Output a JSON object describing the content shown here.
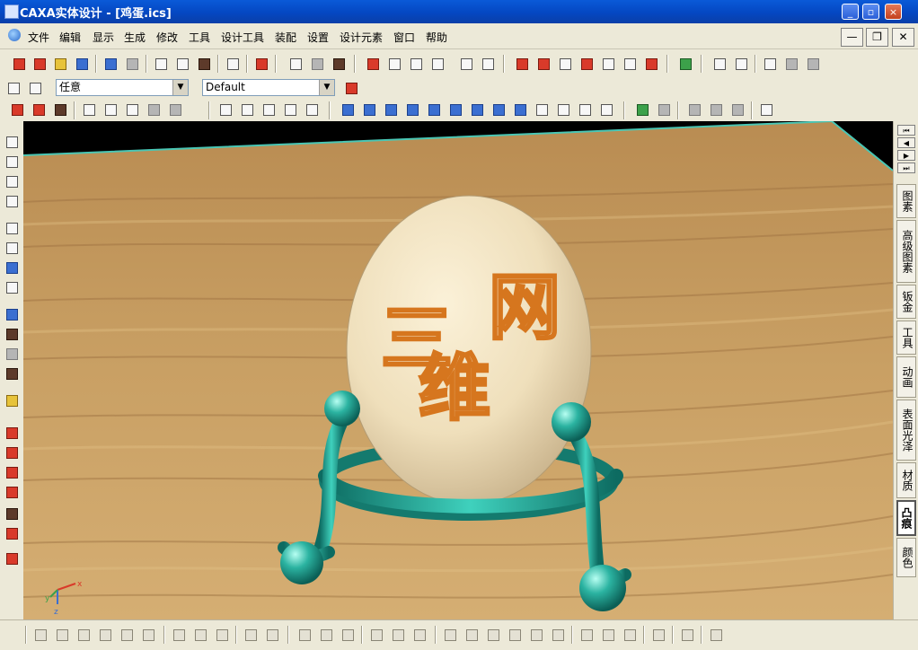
{
  "window": {
    "title": "CAXA实体设计 - [鸡蛋.ics]",
    "minimize": "_",
    "maximize": "▫",
    "close": "×"
  },
  "menu": {
    "items": [
      {
        "label": "文件"
      },
      {
        "label": "编辑"
      },
      {
        "label": "显示"
      },
      {
        "label": "生成"
      },
      {
        "label": "修改"
      },
      {
        "label": "工具"
      },
      {
        "label": "设计工具"
      },
      {
        "label": "装配"
      },
      {
        "label": "设置"
      },
      {
        "label": "设计元素"
      },
      {
        "label": "窗口"
      },
      {
        "label": "帮助"
      }
    ],
    "doc_minimize": "—",
    "doc_restore": "❐",
    "doc_close": "✕"
  },
  "selection": {
    "filter_value": "任意",
    "layer_value": "Default"
  },
  "design_elements": {
    "tabs": [
      "图素",
      "高级图素",
      "钣金",
      "工具",
      "动画",
      "表面光泽",
      "材质",
      "凸痕",
      "颜色"
    ],
    "active_tab": "凸痕"
  },
  "scene": {
    "egg_text": [
      "三",
      "网",
      "维"
    ],
    "colors": {
      "egg": "#f1e3c2",
      "embossed_text": "#d6761e",
      "stand": "#1f9a8b",
      "table_wood": "#c79a5a"
    },
    "axis_labels": {
      "x": "x",
      "y": "y",
      "z": "z"
    }
  },
  "icons": {
    "toolbar1": [
      "new-icon",
      "open-icon",
      "open-folder-icon",
      "save-icon",
      "undo-icon",
      "redo-icon",
      "import-icon",
      "export-icon",
      "print-icon",
      "zoom-icon",
      "help-icon",
      "smart-render-icon",
      "light-icon",
      "camera-icon",
      "pull-icon",
      "rotate-icon",
      "spin-icon",
      "sweep-icon",
      "text-icon",
      "mirror-icon",
      "arrow-icon",
      "pattern-icon",
      "scale-icon",
      "deform-icon",
      "bend-icon",
      "twist-icon",
      "cut-icon",
      "assembly-icon",
      "eyedropper-icon",
      "paint-icon",
      "material-icon",
      "texture-icon",
      "sphere-icon"
    ]
  }
}
